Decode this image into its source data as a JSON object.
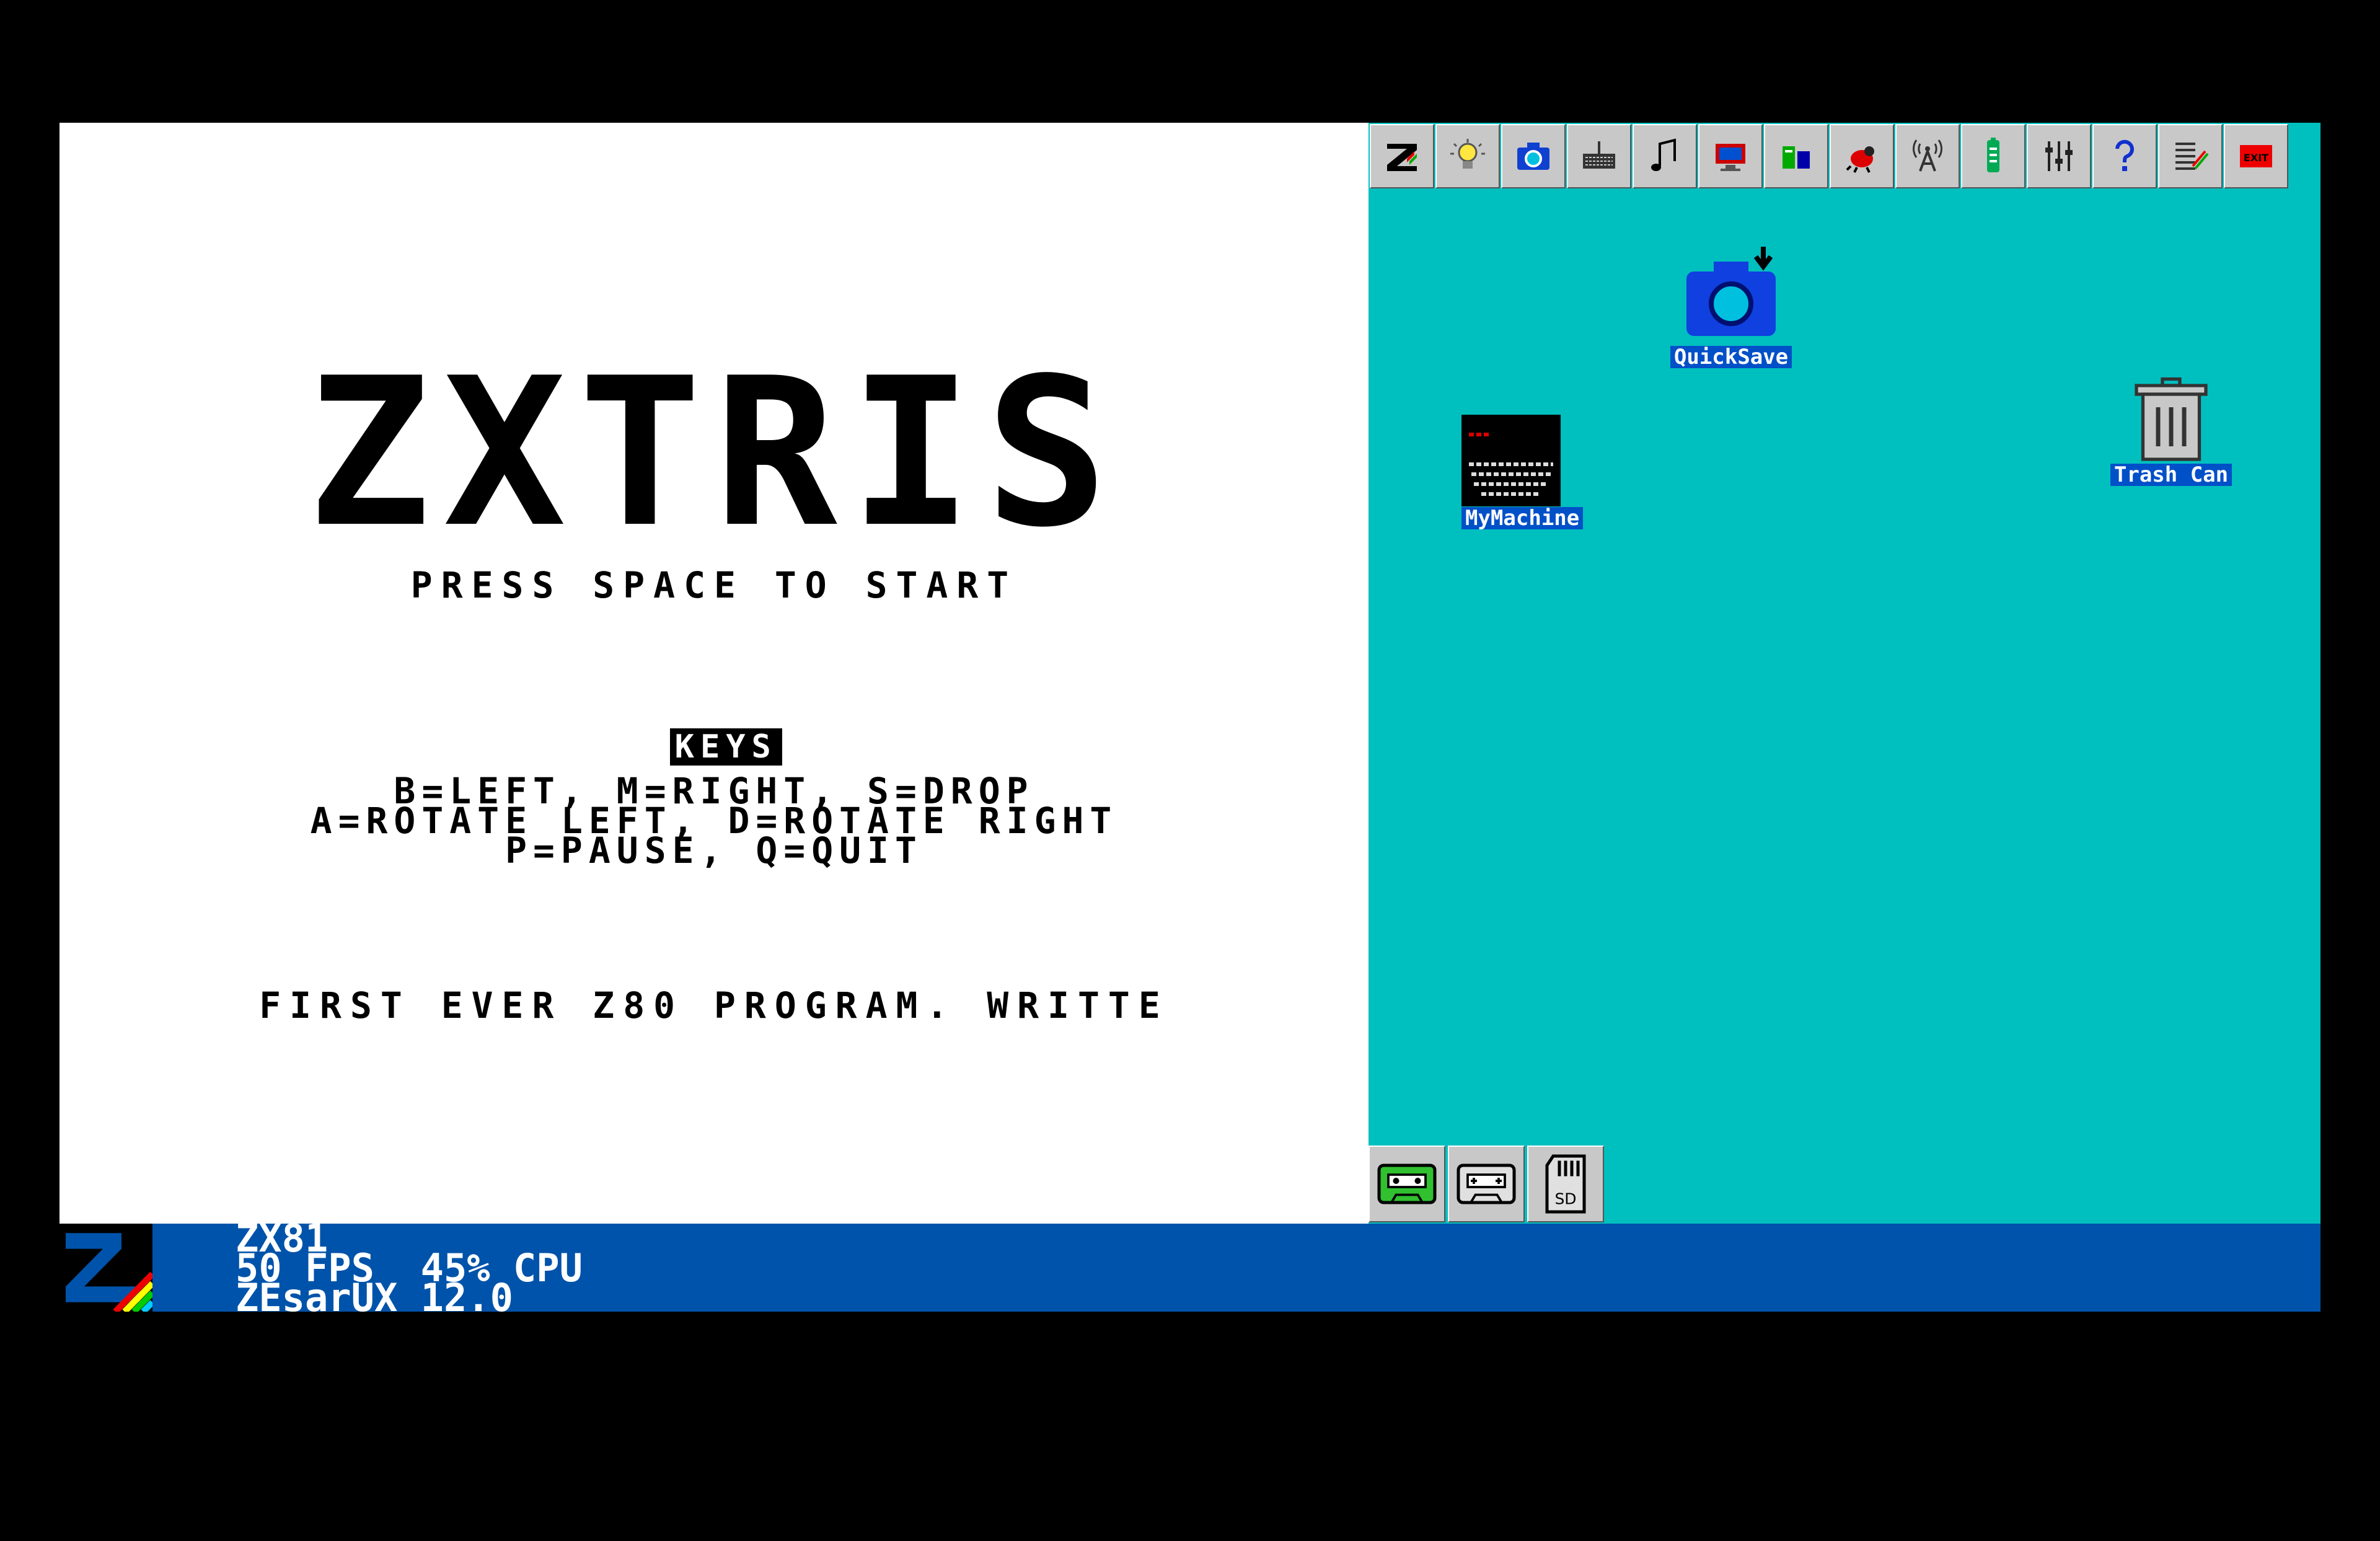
{
  "emulator": {
    "title": "ZXTRIS",
    "press_start": "PRESS SPACE TO START",
    "keys_heading": "KEYS",
    "keys_line_1": "B=LEFT, M=RIGHT, S=DROP",
    "keys_line_2": "A=ROTATE LEFT, D=ROTATE RIGHT",
    "keys_line_3": "P=PAUSE, Q=QUIT",
    "credit_line": "FIRST EVER Z80 PROGRAM. WRITTE"
  },
  "toolbar": {
    "buttons": [
      {
        "name": "zesarux-menu",
        "icon": "z-logo-icon"
      },
      {
        "name": "smart-load",
        "icon": "lightbulb-icon"
      },
      {
        "name": "snapshot",
        "icon": "camera-icon"
      },
      {
        "name": "keyboard",
        "icon": "keyboard-icon"
      },
      {
        "name": "audio",
        "icon": "music-note-icon"
      },
      {
        "name": "display",
        "icon": "display-icon"
      },
      {
        "name": "storage",
        "icon": "storage-icon"
      },
      {
        "name": "debug",
        "icon": "bug-icon"
      },
      {
        "name": "network",
        "icon": "antenna-icon"
      },
      {
        "name": "windows",
        "icon": "battery-icon"
      },
      {
        "name": "settings",
        "icon": "sliders-icon"
      },
      {
        "name": "help",
        "icon": "question-icon"
      },
      {
        "name": "machine-select",
        "icon": "machine-list-icon"
      },
      {
        "name": "exit",
        "icon": "exit-icon",
        "label": "EXIT"
      }
    ]
  },
  "desktop": {
    "icons": {
      "quicksave": "QuickSave",
      "mymachine": "MyMachine",
      "trashcan": "Trash Can"
    },
    "bottom_buttons": [
      {
        "name": "tape-player",
        "icon": "cassette-green-icon"
      },
      {
        "name": "tape-recorder",
        "icon": "cassette-icon"
      },
      {
        "name": "sd-card",
        "icon": "sd-card-icon",
        "label": "SD"
      }
    ]
  },
  "status": {
    "machine": "ZX81",
    "performance": "50 FPS  45% CPU",
    "version": "ZEsarUX 12.0"
  },
  "colors": {
    "desktop_bg": "#00bfbf",
    "status_bar_bg": "#0053aa",
    "icon_label_bg": "#0050c8"
  }
}
